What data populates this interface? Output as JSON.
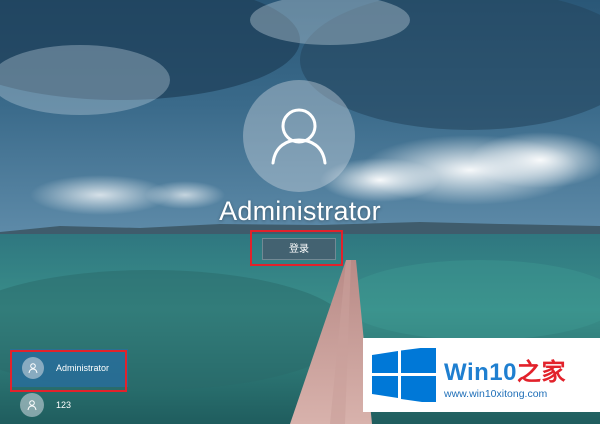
{
  "login": {
    "username": "Administrator",
    "signin_label": "登录"
  },
  "user_list": [
    {
      "name": "Administrator",
      "selected": true
    },
    {
      "name": "123",
      "selected": false
    }
  ],
  "watermark": {
    "title_main": "Win10",
    "title_accent": "之家",
    "url": "www.win10xitong.com"
  },
  "colors": {
    "highlight": "#e2222b",
    "selected_tile": "#286ea0",
    "watermark_blue": "#1f7fd0",
    "logo_blue": "#0078d7"
  },
  "icons": [
    "user-avatar-icon",
    "windows-logo-icon"
  ]
}
